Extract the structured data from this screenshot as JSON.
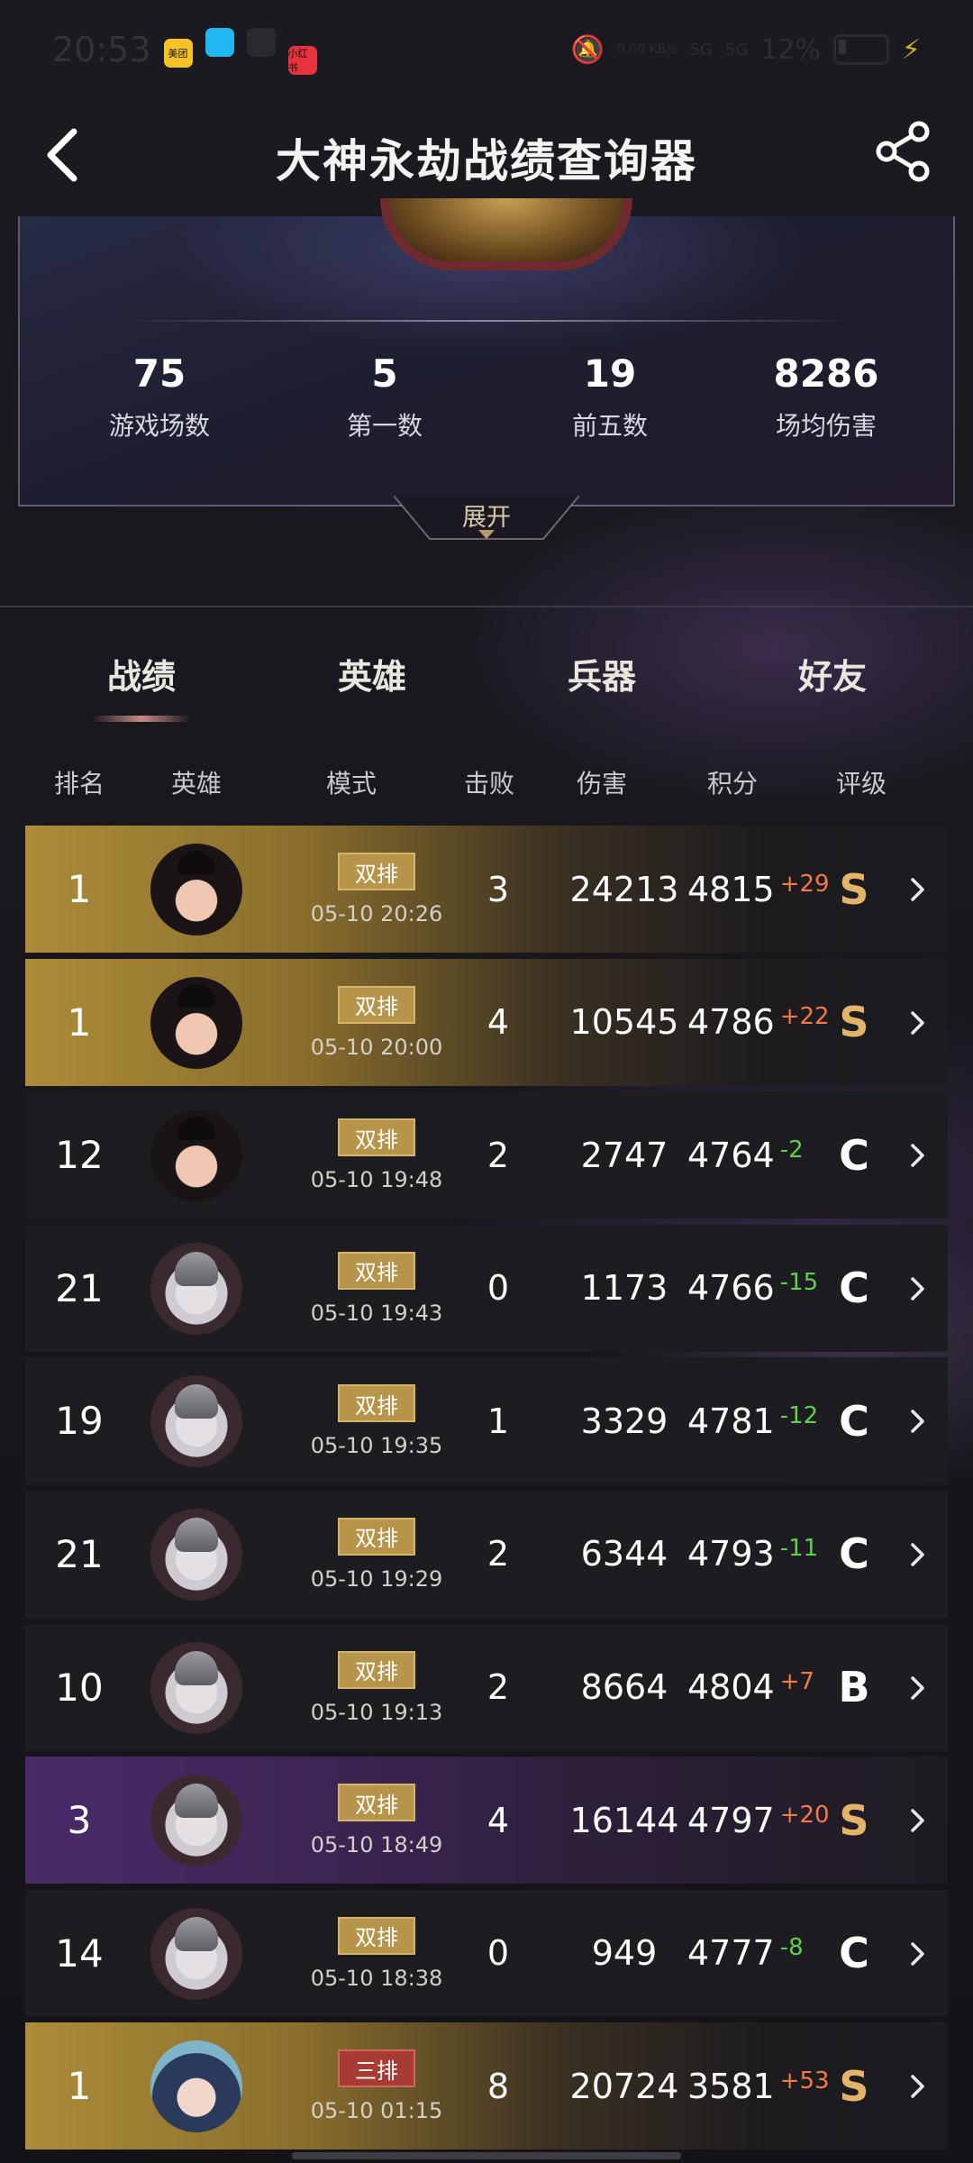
{
  "status_bar": {
    "time": "20:53",
    "apps": [
      {
        "name": "meituan-icon",
        "label": "美团",
        "color": "#f6c326"
      },
      {
        "name": "qq-icon",
        "label": "",
        "color": "#1fb8f0"
      },
      {
        "name": "chat-icon",
        "label": "",
        "color": "#2a2a2e"
      },
      {
        "name": "xiaohongshu-icon",
        "label": "小红书",
        "color": "#e8323c"
      }
    ],
    "network_speed": "0.00 KB/s",
    "signal1": "5G",
    "signal2": "5G",
    "battery": "12%"
  },
  "header": {
    "title": "大神永劫战绩查询器"
  },
  "stats": [
    {
      "value": "75",
      "label": "游戏场数"
    },
    {
      "value": "5",
      "label": "第一数"
    },
    {
      "value": "19",
      "label": "前五数"
    },
    {
      "value": "8286",
      "label": "场均伤害"
    }
  ],
  "expand_label": "展开",
  "tabs": [
    {
      "label": "战绩",
      "active": true
    },
    {
      "label": "英雄",
      "active": false
    },
    {
      "label": "兵器",
      "active": false
    },
    {
      "label": "好友",
      "active": false
    }
  ],
  "columns": [
    "排名",
    "英雄",
    "模式",
    "击败",
    "伤害",
    "积分",
    "评级"
  ],
  "matches": [
    {
      "rank": "1",
      "hero": "girl",
      "mode": "双排",
      "time": "05-10 20:26",
      "kills": "3",
      "damage": "24213",
      "score": "4815",
      "delta": "+29",
      "grade": "S",
      "bg": "gold"
    },
    {
      "rank": "1",
      "hero": "girl",
      "mode": "双排",
      "time": "05-10 20:00",
      "kills": "4",
      "damage": "10545",
      "score": "4786",
      "delta": "+22",
      "grade": "S",
      "bg": "gold"
    },
    {
      "rank": "12",
      "hero": "girl",
      "mode": "双排",
      "time": "05-10 19:48",
      "kills": "2",
      "damage": "2747",
      "score": "4764",
      "delta": "-2",
      "grade": "C",
      "bg": "dark"
    },
    {
      "rank": "21",
      "hero": "masked",
      "mode": "双排",
      "time": "05-10 19:43",
      "kills": "0",
      "damage": "1173",
      "score": "4766",
      "delta": "-15",
      "grade": "C",
      "bg": "dark"
    },
    {
      "rank": "19",
      "hero": "masked",
      "mode": "双排",
      "time": "05-10 19:35",
      "kills": "1",
      "damage": "3329",
      "score": "4781",
      "delta": "-12",
      "grade": "C",
      "bg": "dark"
    },
    {
      "rank": "21",
      "hero": "masked",
      "mode": "双排",
      "time": "05-10 19:29",
      "kills": "2",
      "damage": "6344",
      "score": "4793",
      "delta": "-11",
      "grade": "C",
      "bg": "dark"
    },
    {
      "rank": "10",
      "hero": "masked",
      "mode": "双排",
      "time": "05-10 19:13",
      "kills": "2",
      "damage": "8664",
      "score": "4804",
      "delta": "+7",
      "grade": "B",
      "bg": "dark"
    },
    {
      "rank": "3",
      "hero": "masked",
      "mode": "双排",
      "time": "05-10 18:49",
      "kills": "4",
      "damage": "16144",
      "score": "4797",
      "delta": "+20",
      "grade": "S",
      "bg": "purple"
    },
    {
      "rank": "14",
      "hero": "masked",
      "mode": "双排",
      "time": "05-10 18:38",
      "kills": "0",
      "damage": "949",
      "score": "4777",
      "delta": "-8",
      "grade": "C",
      "bg": "dark"
    },
    {
      "rank": "1",
      "hero": "blue",
      "mode": "三排",
      "time": "05-10 01:15",
      "kills": "8",
      "damage": "20724",
      "score": "3581",
      "delta": "+53",
      "grade": "S",
      "bg": "gold"
    }
  ]
}
